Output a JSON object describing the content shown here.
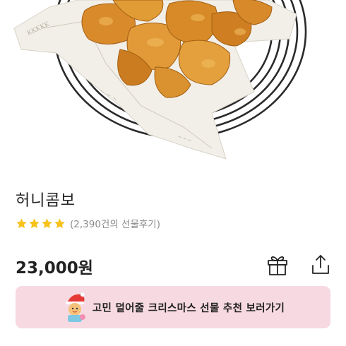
{
  "product": {
    "name": "허니콤보",
    "rating_stars": 4,
    "review_summary": "(2,390건의 선물후기)",
    "price": "23,000원"
  },
  "actions": {
    "gift_icon": "gift-icon",
    "share_icon": "share-icon"
  },
  "banner": {
    "text": "고민 덜어줄 크리스마스 선물 추천 보러가기",
    "icon": "santa-character-icon",
    "background": "#f6d9e1"
  },
  "colors": {
    "star": "#f7c21b",
    "text_secondary": "#8a8a8a",
    "price": "#222222"
  }
}
